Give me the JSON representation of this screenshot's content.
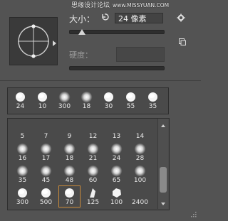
{
  "watermark": {
    "text": "思缘设计论坛",
    "url": "www.MISSYUAN.COM"
  },
  "controls": {
    "size_label": "大小：",
    "size_value": "24 像素",
    "hardness_label": "硬度："
  },
  "recent_brushes": [
    {
      "size": "24",
      "kind": "hard"
    },
    {
      "size": "10",
      "kind": "hard"
    },
    {
      "size": "300",
      "kind": "soft"
    },
    {
      "size": "18",
      "kind": "soft"
    },
    {
      "size": "30",
      "kind": "hard"
    },
    {
      "size": "55",
      "kind": "hard"
    },
    {
      "size": "35",
      "kind": "hard"
    }
  ],
  "brush_grid": [
    {
      "size": "5",
      "kind": "none"
    },
    {
      "size": "7",
      "kind": "none"
    },
    {
      "size": "9",
      "kind": "none"
    },
    {
      "size": "12",
      "kind": "none"
    },
    {
      "size": "13",
      "kind": "none"
    },
    {
      "size": "14",
      "kind": "none"
    },
    {
      "size": "16",
      "kind": "soft"
    },
    {
      "size": "17",
      "kind": "soft"
    },
    {
      "size": "18",
      "kind": "soft"
    },
    {
      "size": "21",
      "kind": "soft"
    },
    {
      "size": "24",
      "kind": "soft"
    },
    {
      "size": "28",
      "kind": "soft"
    },
    {
      "size": "35",
      "kind": "soft"
    },
    {
      "size": "45",
      "kind": "soft"
    },
    {
      "size": "48",
      "kind": "soft"
    },
    {
      "size": "60",
      "kind": "soft"
    },
    {
      "size": "65",
      "kind": "soft"
    },
    {
      "size": "100",
      "kind": "soft"
    },
    {
      "size": "300",
      "kind": "hard"
    },
    {
      "size": "500",
      "kind": "hard"
    },
    {
      "size": "70",
      "kind": "hard",
      "selected": true
    },
    {
      "size": "125",
      "kind": "feather"
    },
    {
      "size": "100",
      "kind": "poly"
    },
    {
      "size": "2400",
      "kind": "none"
    }
  ],
  "icons": {
    "reset": "reset-icon",
    "gear": "gear-icon",
    "new_brush": "new-brush-icon",
    "preview_arrow": "menu-arrow-icon",
    "grip": "resize-grip-icon"
  },
  "colors": {
    "selection": "#c98a3a",
    "panel_bg": "#535353"
  }
}
